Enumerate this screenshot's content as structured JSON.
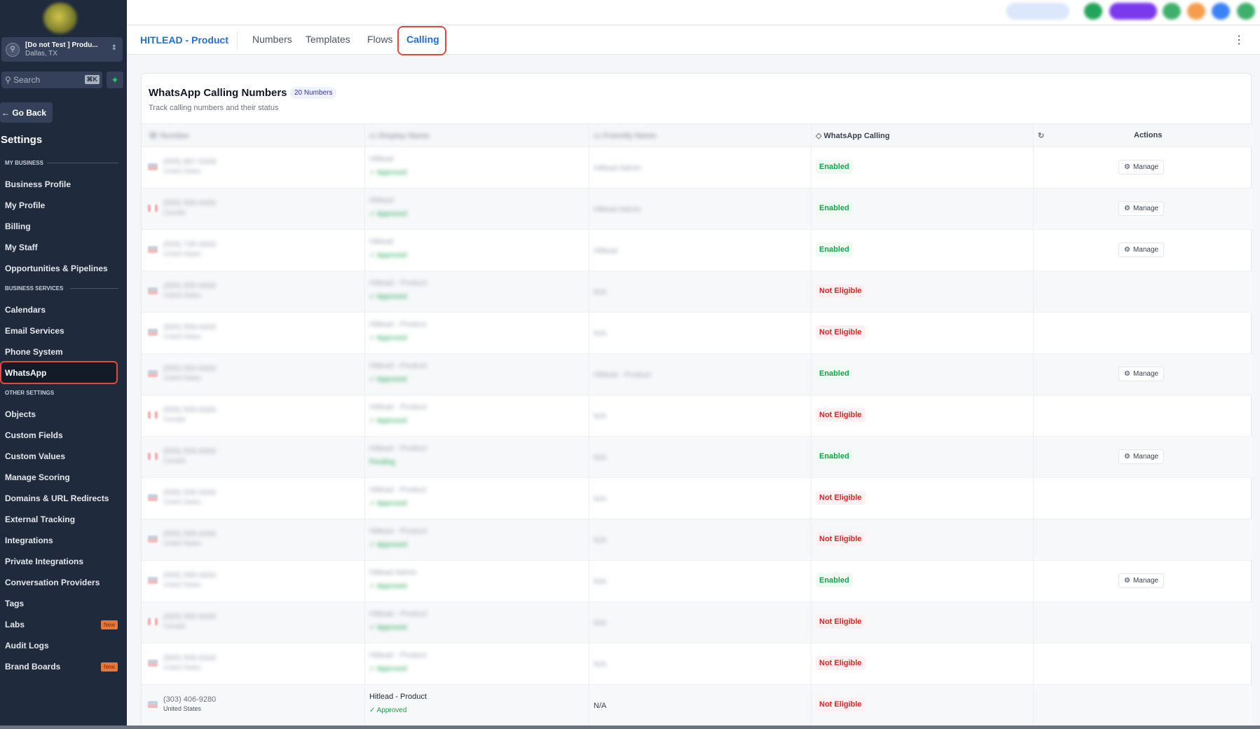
{
  "sidebar": {
    "account": {
      "name": "[Do not Test ] Produ...",
      "location": "Dallas, TX"
    },
    "search": {
      "placeholder": "Search",
      "shortcut": "⌘K"
    },
    "go_back": "Go Back",
    "title": "Settings",
    "sections": [
      {
        "label": "MY BUSINESS",
        "items": [
          "Business Profile",
          "My Profile",
          "Billing",
          "My Staff",
          "Opportunities & Pipelines"
        ]
      },
      {
        "label": "BUSINESS SERVICES",
        "items": [
          "Calendars",
          "Email Services",
          "Phone System",
          "WhatsApp"
        ]
      },
      {
        "label": "OTHER SETTINGS",
        "items": [
          "Objects",
          "Custom Fields",
          "Custom Values",
          "Manage Scoring",
          "Domains & URL Redirects",
          "External Tracking",
          "Integrations",
          "Private Integrations",
          "Conversation Providers",
          "Tags",
          "Labs",
          "Audit Logs",
          "Brand Boards"
        ]
      }
    ],
    "active_item": "WhatsApp",
    "new_badge": "New"
  },
  "header": {
    "brand": "HITLEAD - Product",
    "tabs": [
      "Numbers",
      "Templates",
      "Flows",
      "Calling"
    ],
    "active_tab": "Calling"
  },
  "card": {
    "title": "WhatsApp Calling Numbers",
    "count_badge": "20 Numbers",
    "subtitle": "Track calling numbers and their status"
  },
  "table": {
    "columns": [
      "Number",
      "Display Name",
      "Friendly Name",
      "WhatsApp Calling",
      "",
      "Actions"
    ],
    "manage_label": "Manage",
    "rows": [
      {
        "number": "(555) 867-5309",
        "location": "United States",
        "display": "Hitlead",
        "approval": "✓ Approved",
        "friendly": "Hitlead Admin",
        "status": "Enabled",
        "manage": true,
        "flag": "us"
      },
      {
        "number": "(555) 555-0000",
        "location": "Canada",
        "display": "Hitlead",
        "approval": "✓ Approved",
        "friendly": "Hitlead Admin",
        "status": "Enabled",
        "manage": true,
        "flag": "ca"
      },
      {
        "number": "(555) 735-0000",
        "location": "United States",
        "display": "Hitlead",
        "approval": "✓ Approved",
        "friendly": "Hitlead",
        "status": "Enabled",
        "manage": true,
        "flag": "us"
      },
      {
        "number": "(555) 555-0000",
        "location": "United States",
        "display": "Hitlead - Product",
        "approval": "✓ Approved",
        "friendly": "N/A",
        "status": "Not Eligible",
        "manage": false,
        "flag": "us"
      },
      {
        "number": "(555) 555-0000",
        "location": "United States",
        "display": "Hitlead - Product",
        "approval": "✓ Approved",
        "friendly": "N/A",
        "status": "Not Eligible",
        "manage": false,
        "flag": "us"
      },
      {
        "number": "(555) 555-0000",
        "location": "United States",
        "display": "Hitlead - Product",
        "approval": "✓ Approved",
        "friendly": "Hitlead - Product",
        "status": "Enabled",
        "manage": true,
        "flag": "us"
      },
      {
        "number": "(555) 555-0000",
        "location": "Canada",
        "display": "Hitlead - Product",
        "approval": "✓ Approved",
        "friendly": "N/A",
        "status": "Not Eligible",
        "manage": false,
        "flag": "ca"
      },
      {
        "number": "(555) 555-0000",
        "location": "Canada",
        "display": "Hitlead - Product",
        "approval": "Pending",
        "friendly": "N/A",
        "status": "Enabled",
        "manage": true,
        "flag": "ca"
      },
      {
        "number": "(555) 555-0000",
        "location": "United States",
        "display": "Hitlead - Product",
        "approval": "✓ Approved",
        "friendly": "N/A",
        "status": "Not Eligible",
        "manage": false,
        "flag": "us"
      },
      {
        "number": "(555) 555-0000",
        "location": "United States",
        "display": "Hitlead - Product",
        "approval": "✓ Approved",
        "friendly": "N/A",
        "status": "Not Eligible",
        "manage": false,
        "flag": "us"
      },
      {
        "number": "(555) 555-0000",
        "location": "United States",
        "display": "Hitlead Admin",
        "approval": "✓ Approved",
        "friendly": "N/A",
        "status": "Enabled",
        "manage": true,
        "flag": "us"
      },
      {
        "number": "(555) 555-0000",
        "location": "Canada",
        "display": "Hitlead - Product",
        "approval": "✓ Approved",
        "friendly": "N/A",
        "status": "Not Eligible",
        "manage": false,
        "flag": "ca"
      },
      {
        "number": "(555) 555-0000",
        "location": "United States",
        "display": "Hitlead - Product",
        "approval": "✓ Approved",
        "friendly": "N/A",
        "status": "Not Eligible",
        "manage": false,
        "flag": "us"
      },
      {
        "number": "(303) 406-9280",
        "location": "United States",
        "display": "Hitlead - Product",
        "approval": "✓ Approved",
        "friendly": "N/A",
        "status": "Not Eligible",
        "manage": false,
        "flag": "us",
        "clear": true
      }
    ]
  },
  "colors": {
    "accent": "#1d6fd8",
    "enabled": "#16a34a",
    "not_eligible": "#dc2626",
    "highlight": "#e04a3f",
    "sidebar": "#1f2a3d"
  }
}
